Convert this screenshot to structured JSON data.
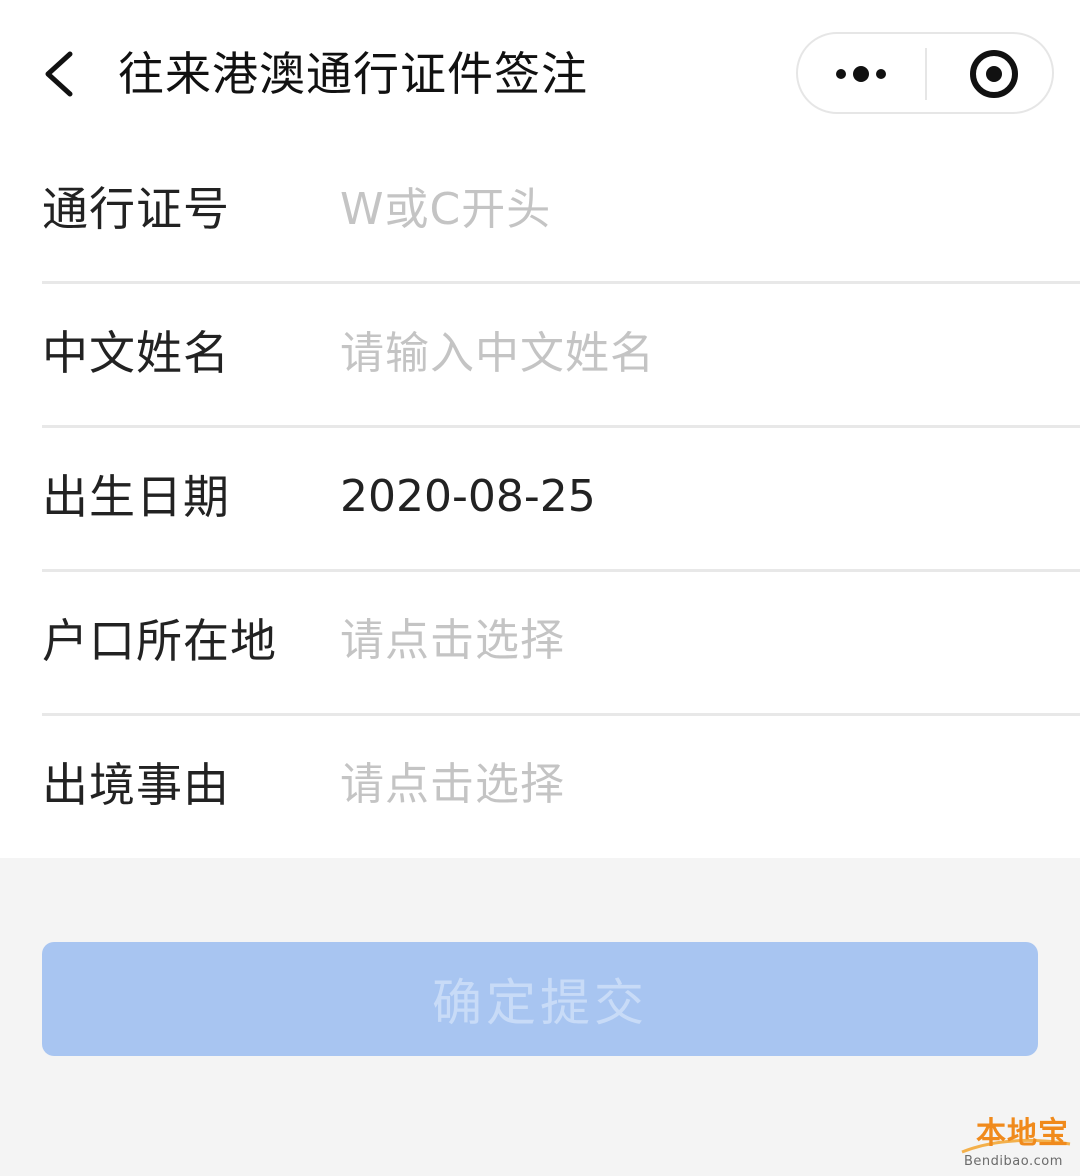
{
  "header": {
    "title": "往来港澳通行证件签注",
    "back_icon": "chevron-left-icon",
    "more_icon": "more-dots-icon",
    "close_icon": "target-close-icon"
  },
  "form": {
    "fields": [
      {
        "label": "通行证号",
        "placeholder": "W或C开头",
        "value": ""
      },
      {
        "label": "中文姓名",
        "placeholder": "请输入中文姓名",
        "value": ""
      },
      {
        "label": "出生日期",
        "value": "2020-08-25"
      },
      {
        "label": "户口所在地",
        "placeholder": "请点击选择"
      },
      {
        "label": "出境事由",
        "placeholder": "请点击选择"
      }
    ]
  },
  "submit": {
    "label": "确定提交"
  },
  "watermark": {
    "name": "本地宝",
    "url": "Bendibao.com"
  },
  "colors": {
    "submit_bg": "#a8c5f1",
    "placeholder": "#c4c4c4",
    "text": "#222222",
    "page_bg": "#f4f4f4"
  }
}
